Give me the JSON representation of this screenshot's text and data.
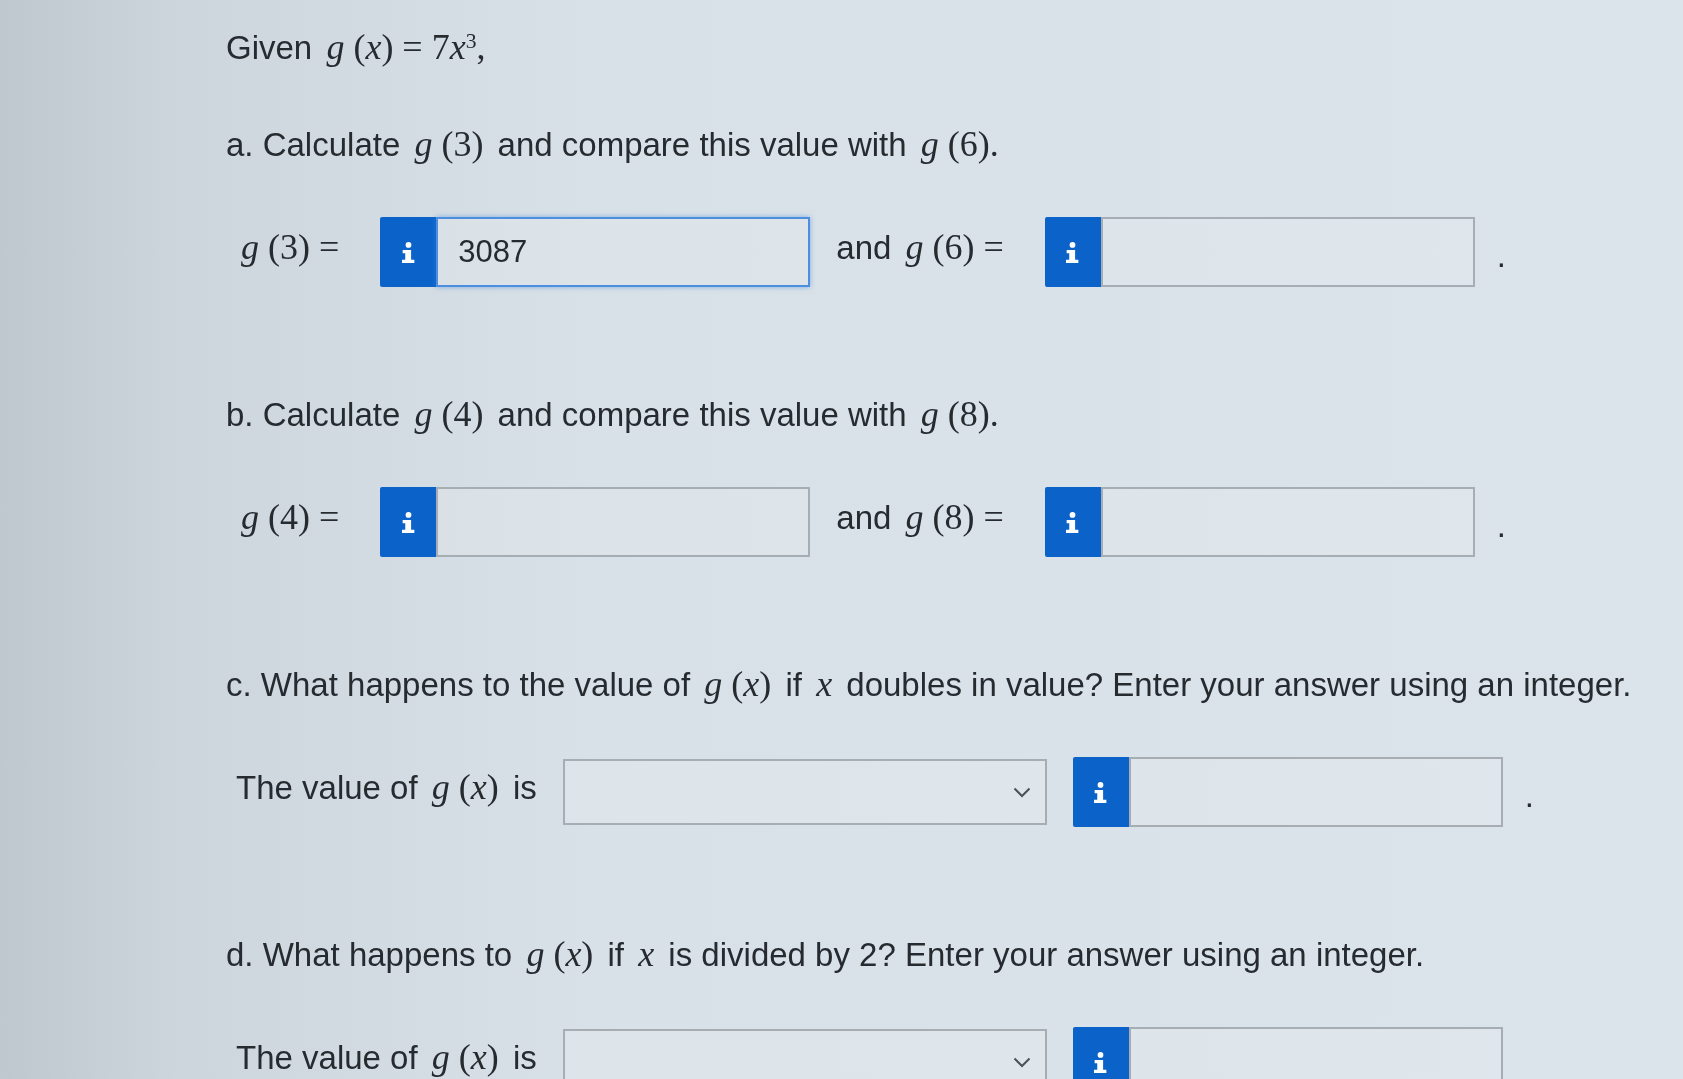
{
  "intro": [
    {
      "kind": "text",
      "text": "Given"
    },
    {
      "kind": "math",
      "text": "*g* (*x*) = 7"
    },
    {
      "kind": "math",
      "text": "*x*$^{3}$,",
      "joined": true
    }
  ],
  "parts": [
    {
      "prompt": [
        {
          "kind": "text",
          "text": "a. Calculate"
        },
        {
          "kind": "math",
          "text": "*g* (3)"
        },
        {
          "kind": "text",
          "text": "and compare this value with"
        },
        {
          "kind": "math",
          "text": "*g* (6)."
        }
      ],
      "answer": {
        "items": [
          {
            "kind": "label",
            "parts": [
              {
                "kind": "math",
                "text": "*g* (3) ="
              }
            ]
          },
          {
            "kind": "input",
            "value": "3087",
            "focused": true
          },
          {
            "kind": "label",
            "parts": [
              {
                "kind": "text",
                "text": "and"
              },
              {
                "kind": "math",
                "text": "*g* (6) ="
              }
            ]
          },
          {
            "kind": "input",
            "focused": false
          }
        ],
        "end": "."
      }
    },
    {
      "prompt": [
        {
          "kind": "text",
          "text": "b. Calculate"
        },
        {
          "kind": "math",
          "text": "*g* (4)"
        },
        {
          "kind": "text",
          "text": "and compare this value with"
        },
        {
          "kind": "math",
          "text": "*g* (8)."
        }
      ],
      "answer": {
        "items": [
          {
            "kind": "label",
            "parts": [
              {
                "kind": "math",
                "text": "*g* (4) ="
              }
            ]
          },
          {
            "kind": "input",
            "focused": false
          },
          {
            "kind": "label",
            "parts": [
              {
                "kind": "text",
                "text": "and"
              },
              {
                "kind": "math",
                "text": "*g* (8) ="
              }
            ]
          },
          {
            "kind": "input",
            "focused": false
          }
        ],
        "end": "."
      }
    },
    {
      "prompt": [
        {
          "kind": "text",
          "text": "c. What happens to the value of"
        },
        {
          "kind": "math",
          "text": "*g* (*x*)"
        },
        {
          "kind": "text",
          "text": "if"
        },
        {
          "kind": "math",
          "text": "*x*"
        },
        {
          "kind": "text",
          "text": "doubles in value? Enter your answer using an integer."
        }
      ],
      "answer": {
        "items": [
          {
            "kind": "label",
            "parts": [
              {
                "kind": "text",
                "text": "The value of"
              },
              {
                "kind": "math",
                "text": "*g* (*x*)"
              },
              {
                "kind": "text",
                "text": "is"
              }
            ]
          },
          {
            "kind": "select",
            "focused": false
          },
          {
            "kind": "input",
            "focused": false
          }
        ],
        "end": "."
      }
    },
    {
      "prompt": [
        {
          "kind": "text",
          "text": "d. What happens to"
        },
        {
          "kind": "math",
          "text": "*g* (*x*)"
        },
        {
          "kind": "text",
          "text": "if"
        },
        {
          "kind": "math",
          "text": "*x*"
        },
        {
          "kind": "text",
          "text": "is divided by 2? Enter your answer using an integer."
        }
      ],
      "answer": {
        "items": [
          {
            "kind": "label",
            "parts": [
              {
                "kind": "text",
                "text": "The value of"
              },
              {
                "kind": "math",
                "text": "*g* (*x*)"
              },
              {
                "kind": "text",
                "text": "is"
              }
            ]
          },
          {
            "kind": "select",
            "focused": false
          },
          {
            "kind": "input",
            "focused": false
          }
        ]
      }
    }
  ]
}
